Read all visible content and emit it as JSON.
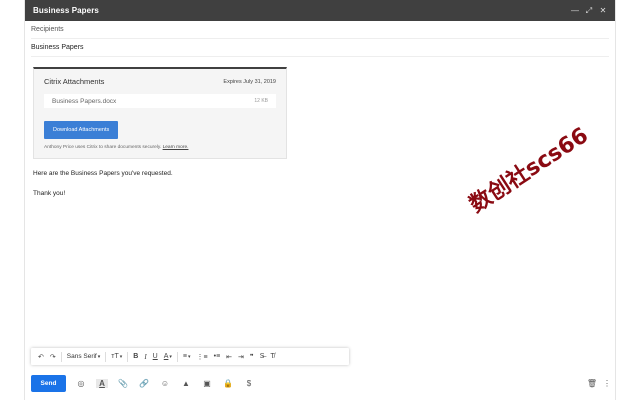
{
  "window": {
    "title": "Business Papers",
    "controls": [
      "—",
      "⤢",
      "✕"
    ]
  },
  "fields": {
    "recipients_placeholder": "Recipients",
    "subject": "Business Papers"
  },
  "attachment": {
    "title": "Citrix Attachments",
    "expires": "Expires July 31, 2019",
    "file_name": "Business Papers.docx",
    "file_size": "12 KB",
    "button": "Download Attachments",
    "footer": "Anthony Price uses Citrix to share documents securely.",
    "learn_more": "Learn more."
  },
  "message": {
    "line1": "Here are the Business Papers you've requested.",
    "line2": "Thank you!"
  },
  "watermark": "数创社scs66",
  "format_toolbar": {
    "undo": "↶",
    "redo": "↷",
    "font": "Sans Serif",
    "size": "тT",
    "bold": "B",
    "italic": "I",
    "underline": "U",
    "color": "A",
    "align": "≡",
    "numbered": "⋮≡",
    "bulleted": "•≡",
    "indent_less": "⇤",
    "indent_more": "⇥",
    "quote": "❞",
    "strike": "S̶",
    "clear": "T̸"
  },
  "bottom_bar": {
    "send": "Send",
    "icons": [
      "◎",
      "A",
      "📎",
      "🔗",
      "☺",
      "▲",
      "▣",
      "🔒",
      "$"
    ],
    "trash": "🗑",
    "more": "⋮"
  }
}
